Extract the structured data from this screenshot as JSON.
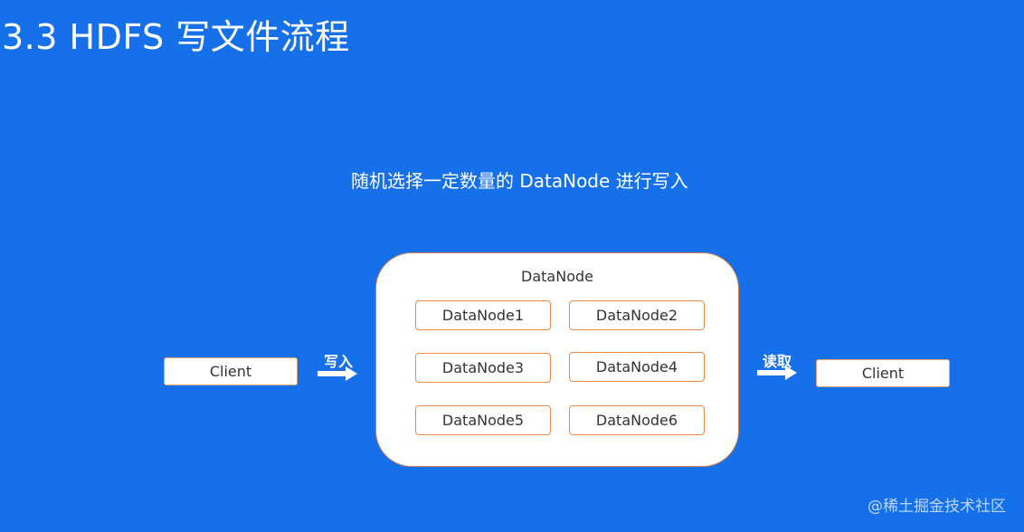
{
  "slide": {
    "title": "3.3 HDFS 写文件流程",
    "subtitle": "随机选择一定数量的 DataNode 进行写入"
  },
  "diagram": {
    "client_left": "Client",
    "client_right": "Client",
    "write_label": "写入",
    "read_label": "读取",
    "cluster_label": "DataNode",
    "nodes": [
      "DataNode1",
      "DataNode2",
      "DataNode3",
      "DataNode4",
      "DataNode5",
      "DataNode6"
    ]
  },
  "watermark": "@稀土掘金技术社区",
  "colors": {
    "background": "#1570ea",
    "box_border": "#e8894a",
    "box_fill": "#ffffff",
    "text_dark": "#333333",
    "text_light": "#ffffff"
  }
}
